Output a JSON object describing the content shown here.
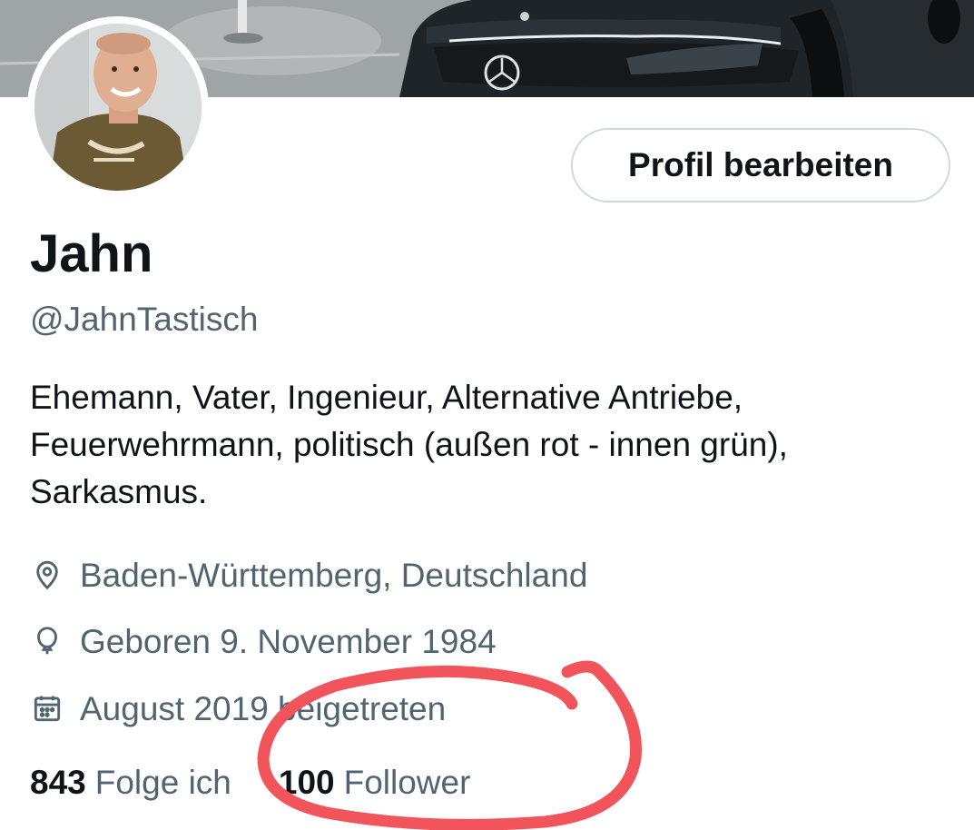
{
  "profile": {
    "display_name": "Jahn",
    "handle": "@JahnTastisch",
    "bio_lines": [
      "Ehemann, Vater, Ingenieur, Alternative Antriebe,",
      "Feuerwehrmann, politisch (außen rot - innen grün),",
      "Sarkasmus."
    ],
    "location": "Baden-Württemberg, Deutschland",
    "birthday": "Geboren 9. November 1984",
    "joined": "August 2019 beigetreten"
  },
  "actions": {
    "edit_profile_label": "Profil bearbeiten"
  },
  "stats": {
    "following_count": "843",
    "following_label": "Folge ich",
    "followers_count": "100",
    "followers_label": "Follower"
  },
  "icons": {
    "location": "location-pin-icon",
    "birthday": "balloon-icon",
    "joined": "calendar-icon"
  },
  "colors": {
    "text_primary": "#0f1419",
    "text_secondary": "#536471",
    "button_border": "#cfd9de",
    "annotation": "#f2545b"
  }
}
